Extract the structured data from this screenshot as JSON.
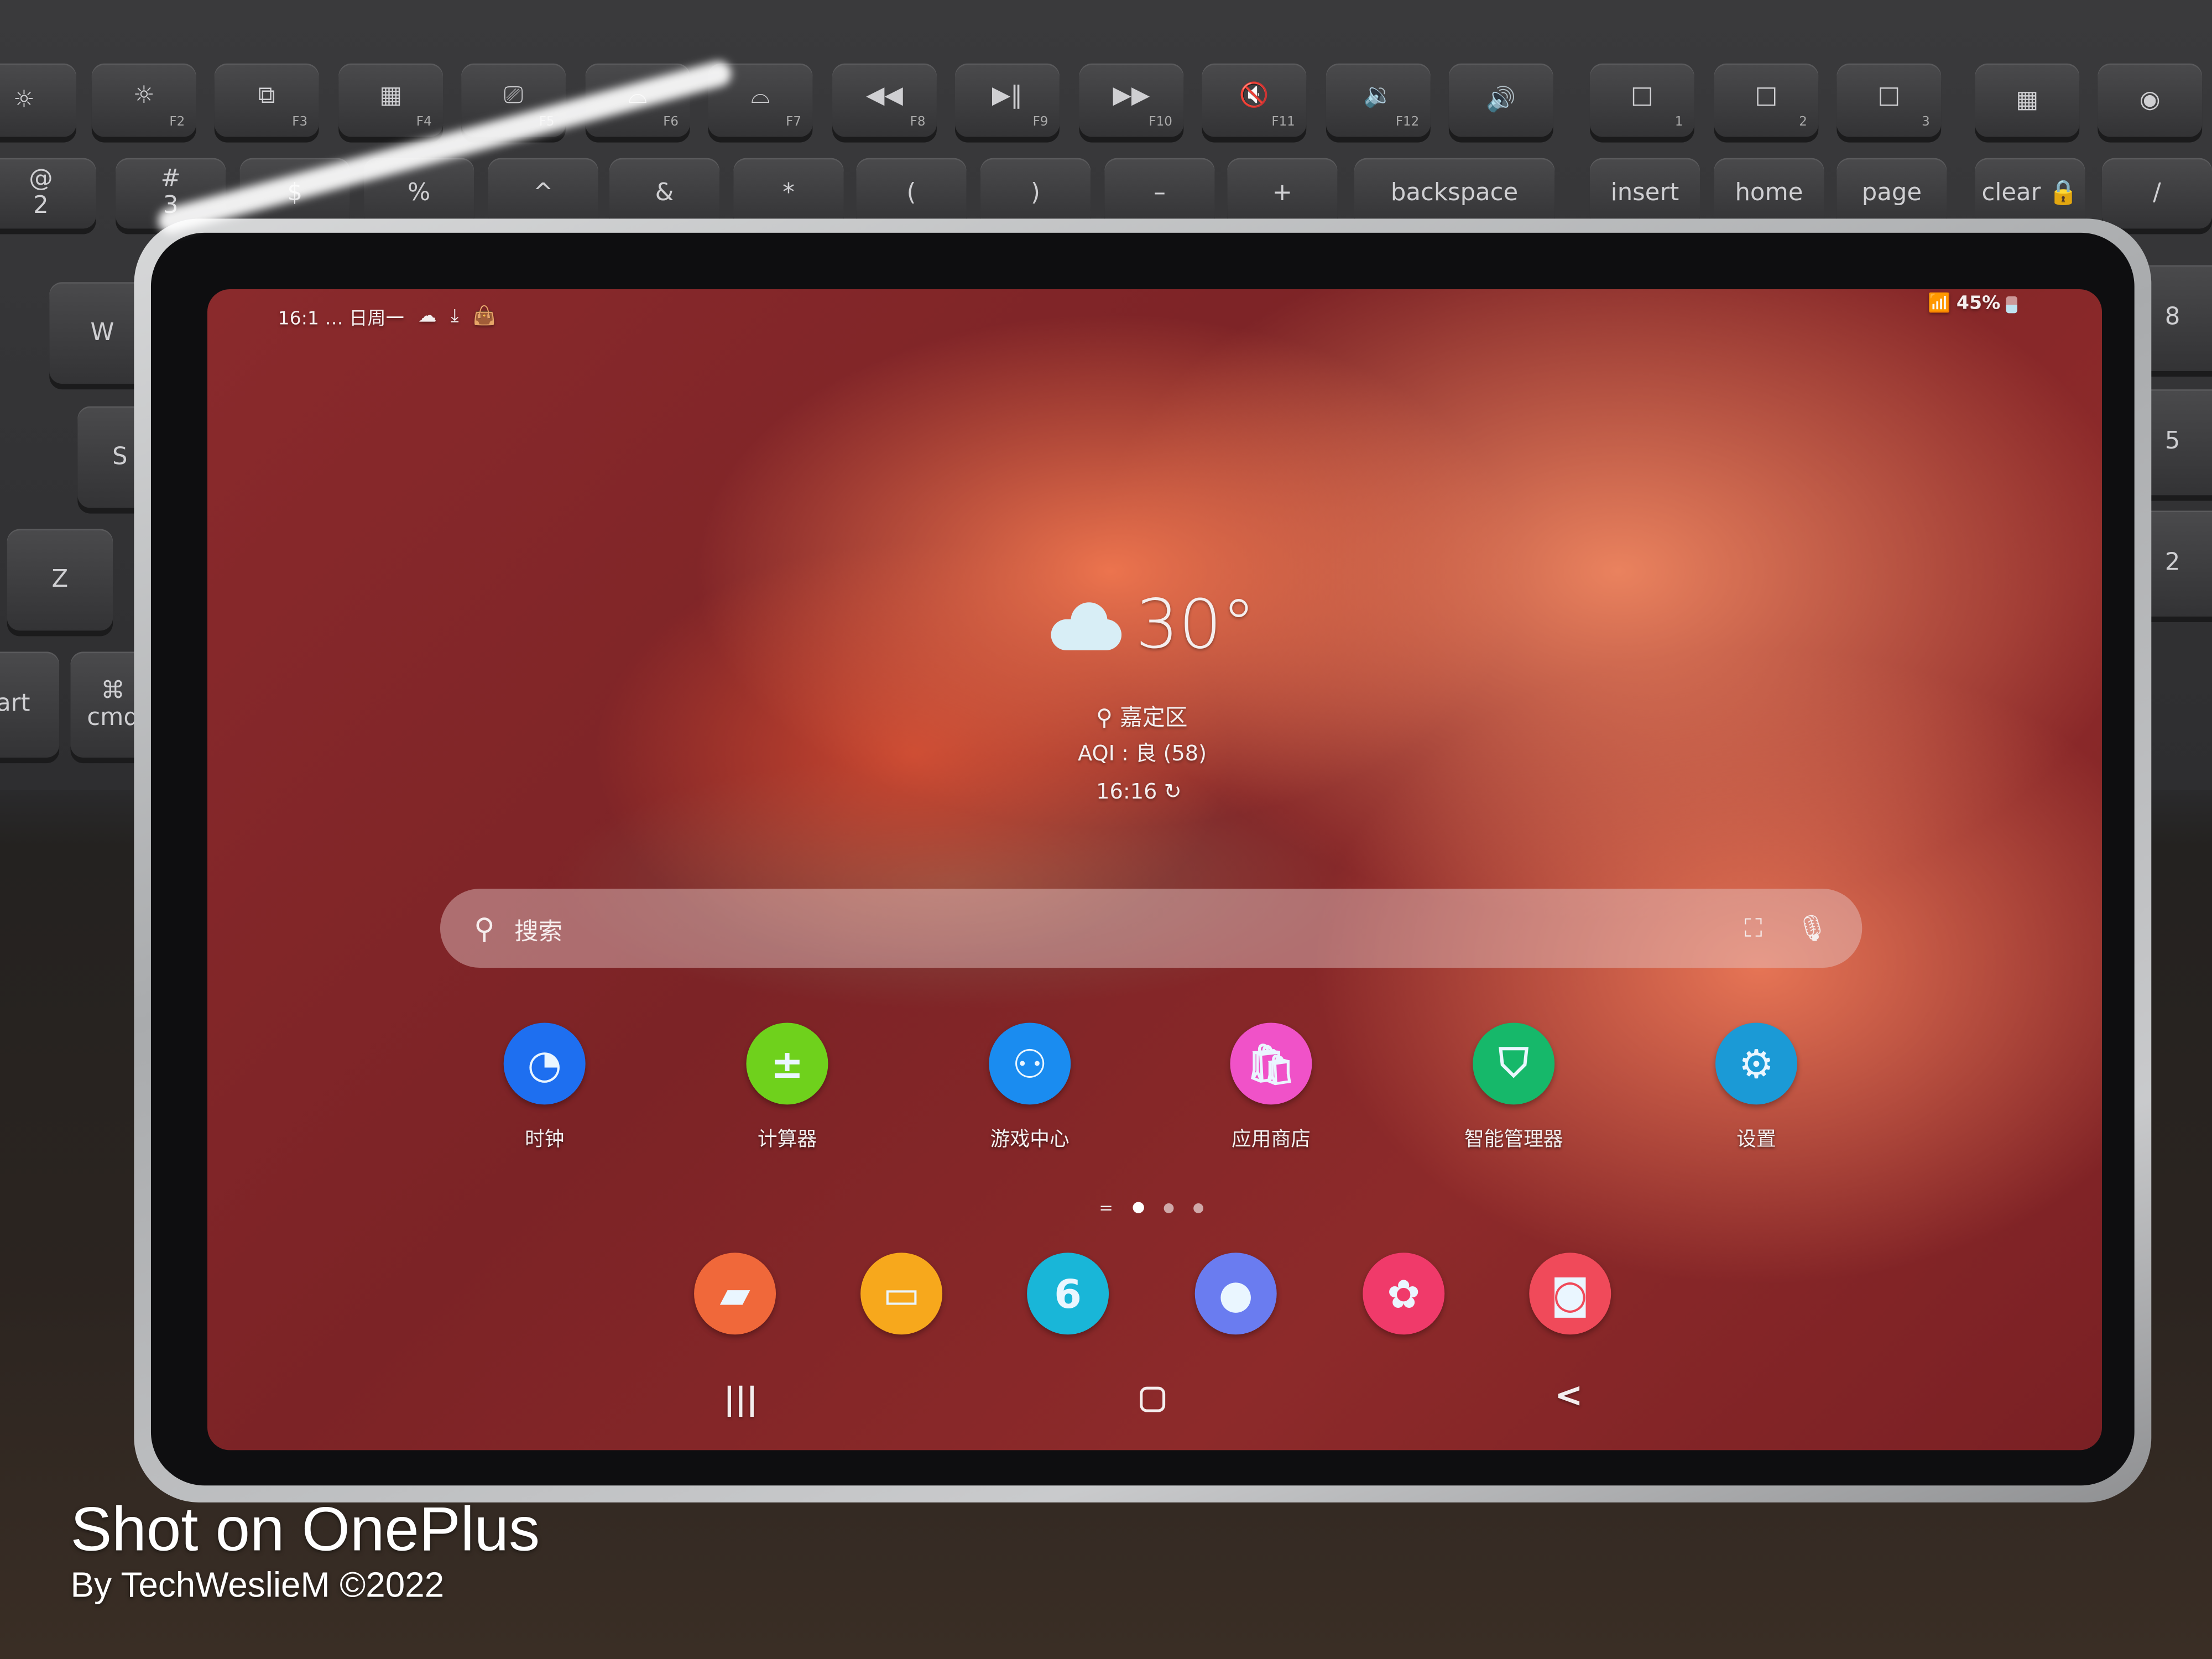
{
  "keyboard": {
    "row1": [
      "",
      "F2",
      "F3",
      "F4",
      "F5",
      "F6",
      "F7",
      "F8",
      "F9",
      "F10",
      "F11",
      "F12",
      "",
      "1",
      "2",
      "3",
      "",
      ""
    ],
    "row1_glyphs": [
      "☼",
      "☼",
      "⧉",
      "▦",
      "⎚",
      "⌓",
      "⌓",
      "◀◀",
      "▶‖",
      "▶▶",
      "🔇",
      "🔉",
      "🔊",
      "□",
      "□",
      "□",
      "▦",
      "◉"
    ],
    "row2": [
      "@\n2",
      "#\n3",
      "$",
      "%",
      "^",
      "&",
      "*",
      "(",
      ")",
      "–",
      "+",
      "backspace",
      "insert",
      "home",
      "page",
      "clear 🔒",
      "/"
    ],
    "side": [
      "W",
      "S",
      "Z",
      "⌘\ncmd",
      "tart",
      "8",
      "5",
      "2"
    ]
  },
  "status_bar": {
    "time_date": "16:1 … 日周一",
    "icons": [
      "cloud-sync-icon",
      "download-icon",
      "bag-icon"
    ],
    "battery": "45%",
    "right_icons": [
      "wifi-icon",
      "battery-icon"
    ]
  },
  "weather": {
    "temperature": "30°",
    "location": "嘉定区",
    "aqi": "AQI : 良 (58)",
    "updated": "16:16",
    "condition_icon": "cloud-icon"
  },
  "search": {
    "placeholder": "搜索"
  },
  "apps": [
    {
      "label": "时钟",
      "icon": "clock-icon",
      "color": "#1e6ff0"
    },
    {
      "label": "计算器",
      "icon": "calculator-icon",
      "color": "#6fd11c"
    },
    {
      "label": "游戏中心",
      "icon": "game-center-icon",
      "color": "#1a8cf0"
    },
    {
      "label": "应用商店",
      "icon": "app-store-icon",
      "color": "#f052c8"
    },
    {
      "label": "智能管理器",
      "icon": "shield-icon",
      "color": "#16b86a"
    },
    {
      "label": "设置",
      "icon": "gear-icon",
      "color": "#1b9ad6"
    }
  ],
  "dock": [
    {
      "icon": "notes-icon",
      "glyph": "▰",
      "color": "#f0683a"
    },
    {
      "icon": "files-icon",
      "glyph": "▭",
      "color": "#f7a81c"
    },
    {
      "icon": "calendar-icon",
      "glyph": "6",
      "color": "#19b6d8"
    },
    {
      "icon": "browser-icon",
      "glyph": "●",
      "color": "#6a7cf0"
    },
    {
      "icon": "gallery-icon",
      "glyph": "✿",
      "color": "#f03a6a"
    },
    {
      "icon": "camera-icon",
      "glyph": "◙",
      "color": "#f04a5a"
    }
  ],
  "page_indicator": {
    "pages": 3,
    "current": 1
  },
  "nav": {
    "recents": "|||",
    "home": "○",
    "back": "<"
  },
  "watermark": {
    "title": "Shot on OnePlus",
    "credit": "By TechWeslieM ©2022"
  }
}
